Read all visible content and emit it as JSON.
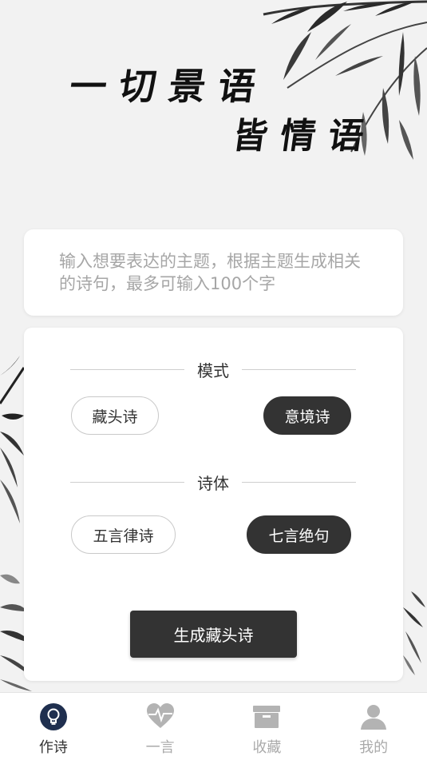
{
  "colors": {
    "ink": "#333333",
    "background": "#f2f2f2",
    "active_tab": "#1f2f4f",
    "inactive": "#b3b3b3"
  },
  "header": {
    "line1": "一切景语",
    "line2": "皆情语"
  },
  "theme_input": {
    "placeholder": "输入想要表达的主题，根据主题生成相关的诗句，最多可输入100个字",
    "value": ""
  },
  "mode": {
    "title": "模式",
    "options": [
      {
        "label": "藏头诗",
        "selected": false
      },
      {
        "label": "意境诗",
        "selected": true
      }
    ]
  },
  "form": {
    "title": "诗体",
    "options": [
      {
        "label": "五言律诗",
        "selected": false
      },
      {
        "label": "七言绝句",
        "selected": true
      }
    ]
  },
  "generate_button": {
    "label": "生成藏头诗"
  },
  "tabbar": {
    "items": [
      {
        "label": "作诗",
        "icon": "lightbulb-icon",
        "active": true
      },
      {
        "label": "一言",
        "icon": "heart-pulse-icon",
        "active": false
      },
      {
        "label": "收藏",
        "icon": "box-icon",
        "active": false
      },
      {
        "label": "我的",
        "icon": "user-icon",
        "active": false
      }
    ]
  }
}
